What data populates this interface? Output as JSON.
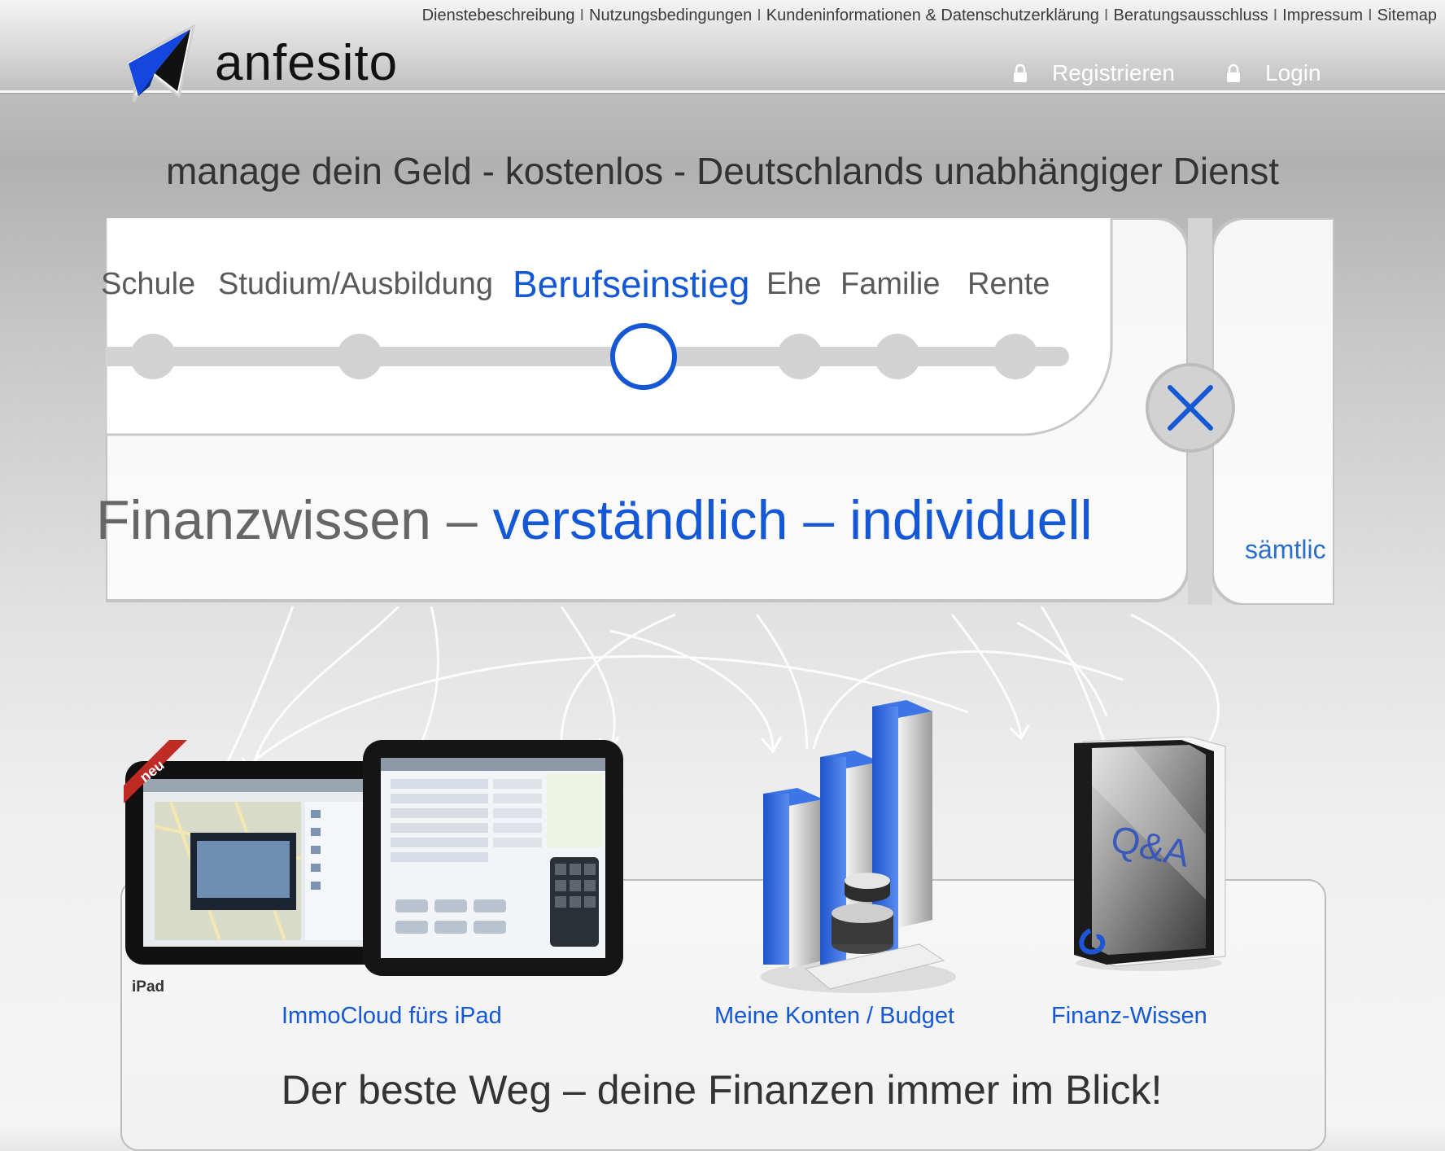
{
  "topnav": {
    "items": [
      "Dienstebeschreibung",
      "Nutzungsbedingungen",
      "Kundeninformationen & Datenschutzerklärung",
      "Beratungsausschluss",
      "Impressum",
      "Sitemap"
    ],
    "separator": "I"
  },
  "logo": {
    "text": "anfesito",
    "icon": "paper-plane-logo-icon"
  },
  "auth": {
    "register": "Registrieren",
    "login": "Login",
    "icon": "lock-icon"
  },
  "tagline": "manage dein Geld - kostenlos - Deutschlands unabhängiger Dienst",
  "slider": {
    "timeline": [
      {
        "label": "Schule",
        "active": false
      },
      {
        "label": "Studium/Ausbildung",
        "active": false
      },
      {
        "label": "Berufseinstieg",
        "active": true
      },
      {
        "label": "Ehe",
        "active": false
      },
      {
        "label": "Familie",
        "active": false
      },
      {
        "label": "Rente",
        "active": false
      }
    ],
    "slogan_prefix": "Finanzwissen – ",
    "slogan_highlight": "verständlich – individuell",
    "next_panel_link": "sämtlic",
    "close_icon": "close-x-icon"
  },
  "features": {
    "ribbon": "neu",
    "device_caption": "iPad",
    "book_label": "Q&A",
    "items": [
      {
        "label": "ImmoCloud fürs iPad",
        "icon": "ipad-devices-image"
      },
      {
        "label": "Meine Konten / Budget",
        "icon": "bar-chart-coins-image"
      },
      {
        "label": "Finanz-Wissen",
        "icon": "qa-book-image"
      }
    ],
    "headline": "Der beste Weg – deine Finanzen immer im Blick!"
  },
  "colors": {
    "accent": "#1558d6",
    "text": "#333333",
    "link": "#1558d6"
  }
}
